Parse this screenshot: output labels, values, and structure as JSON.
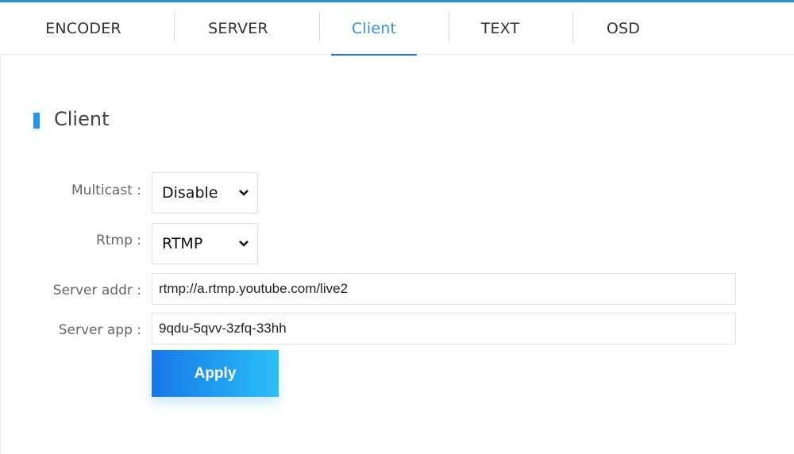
{
  "tabs": [
    {
      "label": "ENCODER",
      "active": false
    },
    {
      "label": "SERVER",
      "active": false
    },
    {
      "label": "Client",
      "active": true
    },
    {
      "label": "TEXT",
      "active": false
    },
    {
      "label": "OSD",
      "active": false
    }
  ],
  "section": {
    "title": "Client"
  },
  "form": {
    "multicast": {
      "label": "Multicast :",
      "value": "Disable"
    },
    "rtmp": {
      "label": "Rtmp :",
      "value": "RTMP"
    },
    "server_addr": {
      "label": "Server addr :",
      "value": "rtmp://a.rtmp.youtube.com/live2"
    },
    "server_app": {
      "label": "Server app :",
      "value": "9qdu-5qvv-3zfq-33hh"
    }
  },
  "apply_label": "Apply",
  "colors": {
    "accent": "#2196f3",
    "active_tab": "#3b8fd9"
  }
}
